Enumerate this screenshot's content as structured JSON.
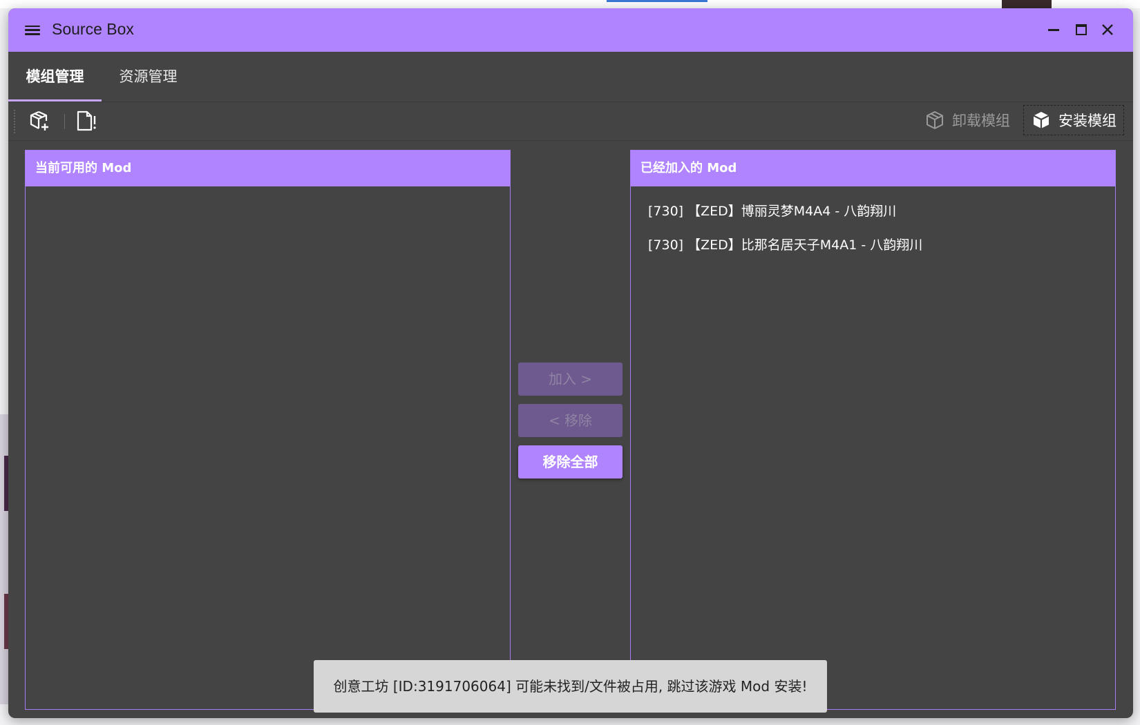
{
  "window": {
    "title": "Source Box"
  },
  "tabs": [
    {
      "label": "模组管理",
      "active": true
    },
    {
      "label": "资源管理",
      "active": false
    }
  ],
  "toolbar": {
    "icons": [
      "package-add-icon",
      "file-alert-icon"
    ],
    "uninstall_label": "卸载模组",
    "install_label": "安装模组"
  },
  "available_panel": {
    "header": "当前可用的 Mod",
    "items": []
  },
  "added_panel": {
    "header": "已经加入的 Mod",
    "items": [
      "[730] 【ZED】博丽灵梦M4A4 - 八韵翔川",
      "[730] 【ZED】比那名居天子M4A1 - 八韵翔川"
    ]
  },
  "actions": {
    "add_label": "加入 >",
    "remove_label": "< 移除",
    "remove_all_label": "移除全部"
  },
  "toast": {
    "message": "创意工坊 [ID:3191706064] 可能未找到/文件被占用, 跳过该游戏 Mod 安装!"
  },
  "colors": {
    "accent": "#b084ff",
    "background": "#444444",
    "disabled_button": "#6e5a8e",
    "toast_bg": "#d6d6d6"
  }
}
